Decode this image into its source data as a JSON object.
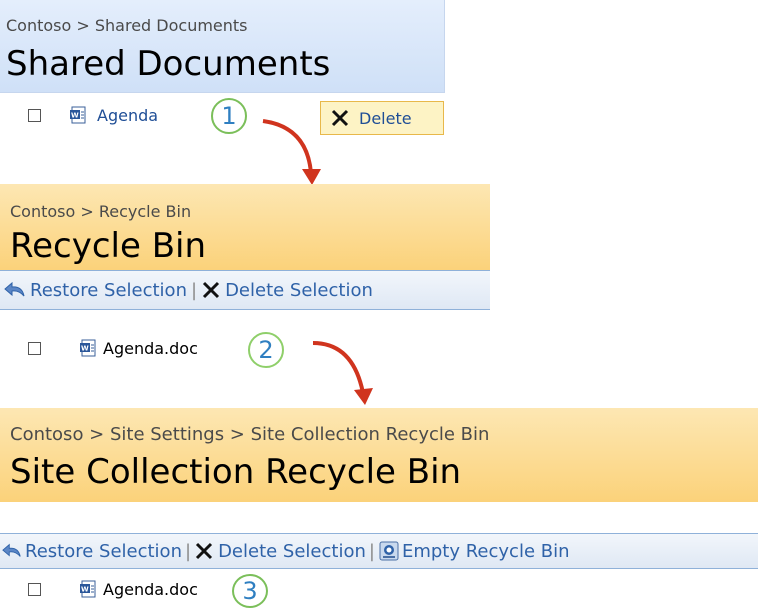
{
  "panel1": {
    "breadcrumb": "Contoso > Shared Documents",
    "title": "Shared Documents",
    "item": "Agenda",
    "delete_label": "Delete",
    "step": "1"
  },
  "panel2": {
    "breadcrumb": "Contoso > Recycle Bin",
    "title": "Recycle Bin",
    "toolbar": {
      "restore": "Restore Selection",
      "delete": "Delete Selection",
      "sep": "|"
    },
    "item": "Agenda.doc",
    "step": "2"
  },
  "panel3": {
    "breadcrumb": "Contoso > Site Settings > Site Collection Recycle Bin",
    "title": "Site Collection Recycle Bin",
    "toolbar": {
      "restore": "Restore Selection",
      "delete": "Delete Selection",
      "empty": "Empty Recycle Bin",
      "sep": "|"
    },
    "item": "Agenda.doc",
    "step": "3"
  },
  "colors": {
    "blue_header": "#dbe8fa",
    "orange_header": "#fde3a4",
    "link_blue": "#1f4e96",
    "step_ring": "#7bbf5a",
    "arrow_red": "#d0341e"
  },
  "icons": [
    "checkbox",
    "word-doc-icon",
    "delete-x-icon",
    "restore-arrow-icon",
    "empty-bin-icon",
    "curved-arrow-icon"
  ]
}
